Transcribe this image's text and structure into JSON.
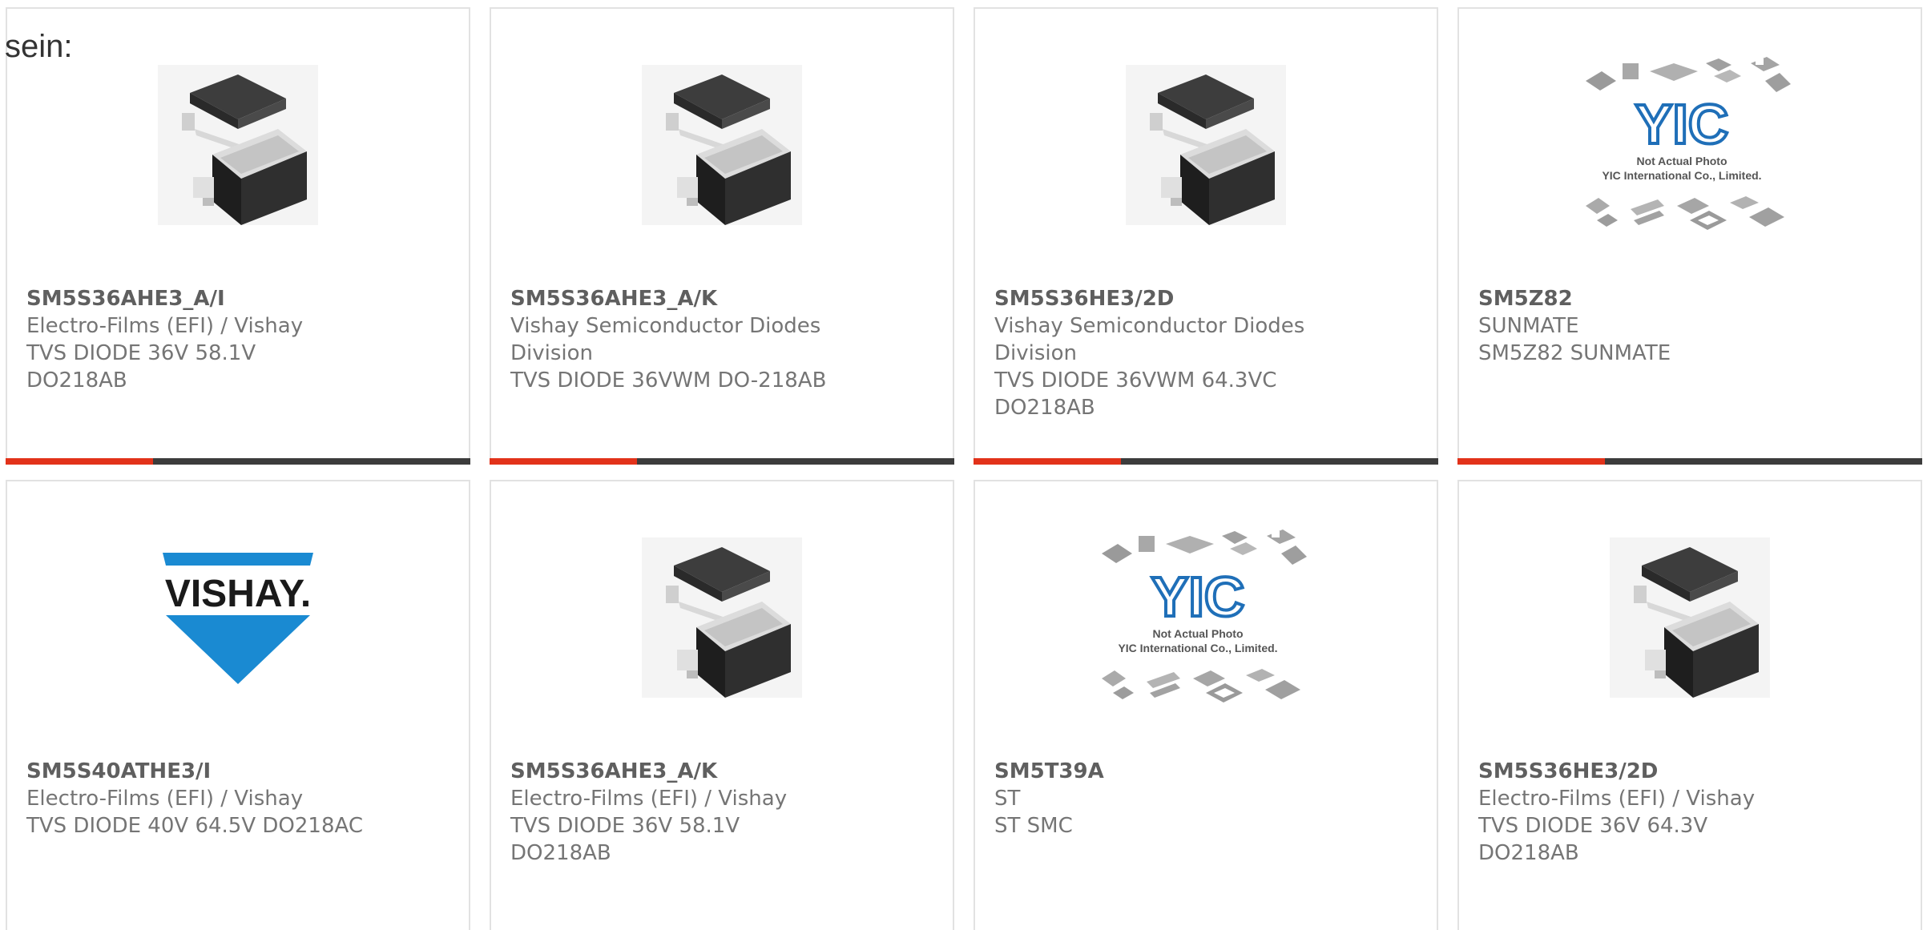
{
  "intro_text": "sein:",
  "colors": {
    "accent": "#e2321a",
    "bar_dark": "#3c3c3c",
    "border": "#e2e2e2",
    "vishay_blue": "#1a8ad2",
    "yic_blue": "#1f6fb8"
  },
  "products": [
    {
      "part": "SM5S36AHE3_A/I",
      "manufacturer": "Electro-Films (EFI) / Vishay",
      "description": "TVS DIODE 36V 58.1V DO218AB",
      "image": "diode-package-icon"
    },
    {
      "part": "SM5S36AHE3_A/K",
      "manufacturer": "Vishay Semiconductor Diodes Division",
      "description": "TVS DIODE 36VWM DO-218AB",
      "image": "diode-package-icon"
    },
    {
      "part": "SM5S36HE3/2D",
      "manufacturer": "Vishay Semiconductor Diodes Division",
      "description": "TVS DIODE 36VWM 64.3VC DO218AB",
      "image": "diode-package-icon"
    },
    {
      "part": "SM5Z82",
      "manufacturer": "SUNMATE",
      "description": "SM5Z82 SUNMATE",
      "image": "yic-placeholder-icon",
      "placeholder_caption_1": "Not Actual Photo",
      "placeholder_caption_2": "YIC International Co., Limited."
    },
    {
      "part": "SM5S40ATHE3/I",
      "manufacturer": "Electro-Films (EFI) / Vishay",
      "description": "TVS DIODE 40V 64.5V DO218AC",
      "image": "vishay-logo",
      "logo_text": "VISHAY."
    },
    {
      "part": "SM5S36AHE3_A/K",
      "manufacturer": "Electro-Films (EFI) / Vishay",
      "description": "TVS DIODE 36V 58.1V DO218AB",
      "image": "diode-package-icon"
    },
    {
      "part": "SM5T39A",
      "manufacturer": "ST",
      "description": "ST SMC",
      "image": "yic-placeholder-icon",
      "placeholder_caption_1": "Not Actual Photo",
      "placeholder_caption_2": "YIC International Co., Limited."
    },
    {
      "part": "SM5S36HE3/2D",
      "manufacturer": "Electro-Films (EFI) / Vishay",
      "description": "TVS DIODE 36V 64.3V DO218AB",
      "image": "diode-package-icon"
    }
  ]
}
